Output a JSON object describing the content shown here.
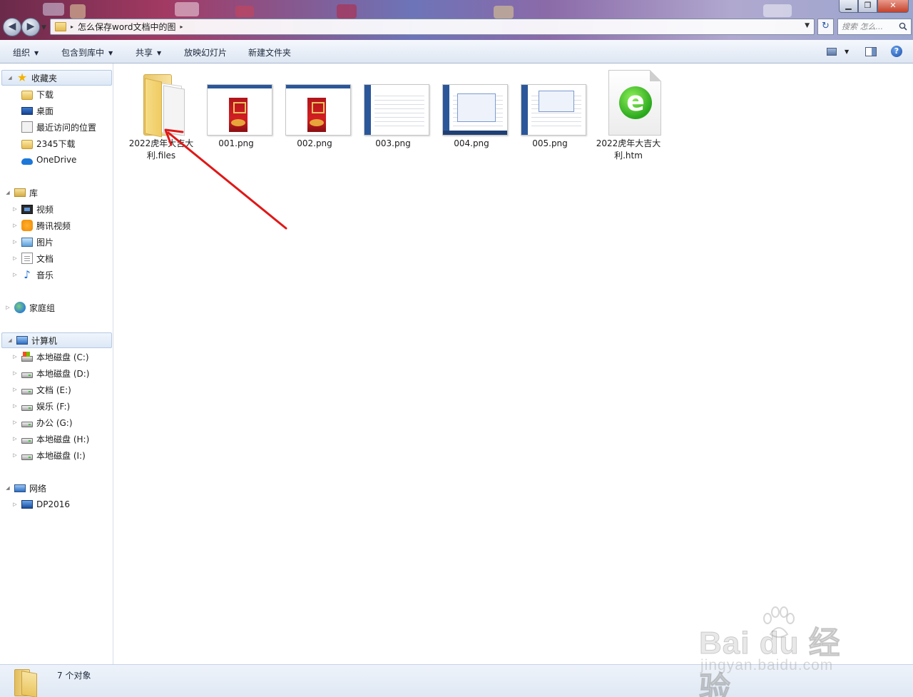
{
  "window": {
    "minimize_glyph": "▁",
    "restore_glyph": "❐",
    "close_glyph": "✕"
  },
  "address": {
    "path": "怎么保存word文档中的图",
    "breadcrumb_separator": "▸",
    "dropdown_glyph": "▼",
    "refresh_glyph": "↻",
    "search_placeholder": "搜索 怎么..."
  },
  "nav": {
    "back_glyph": "◀",
    "forward_glyph": "▶",
    "history_glyph": "▼"
  },
  "toolbar": {
    "organize": "组织",
    "include_in_library": "包含到库中",
    "share": "共享",
    "slideshow": "放映幻灯片",
    "new_folder": "新建文件夹",
    "caret": "▼",
    "help_glyph": "?"
  },
  "sidebar": {
    "expand_open": "◢",
    "expand_closed": "▷",
    "favorites": {
      "label": "收藏夹",
      "items": [
        "下载",
        "桌面",
        "最近访问的位置",
        "2345下载",
        "OneDrive"
      ]
    },
    "libraries": {
      "label": "库",
      "items": [
        "视频",
        "腾讯视频",
        "图片",
        "文档",
        "音乐"
      ]
    },
    "homegroup": {
      "label": "家庭组"
    },
    "computer": {
      "label": "计算机",
      "items": [
        "本地磁盘 (C:)",
        "本地磁盘 (D:)",
        "文档 (E:)",
        "娱乐 (F:)",
        "办公 (G:)",
        "本地磁盘 (H:)",
        "本地磁盘 (I:)"
      ]
    },
    "network": {
      "label": "网络",
      "items": [
        "DP2016"
      ]
    }
  },
  "files": [
    {
      "name": "2022虎年大吉大利.files",
      "type": "folder"
    },
    {
      "name": "001.png",
      "type": "png",
      "preview": "red-poster"
    },
    {
      "name": "002.png",
      "type": "png",
      "preview": "red-poster"
    },
    {
      "name": "003.png",
      "type": "png",
      "preview": "word-document"
    },
    {
      "name": "004.png",
      "type": "png",
      "preview": "dialog-screenshot"
    },
    {
      "name": "005.png",
      "type": "png",
      "preview": "dialog-screenshot"
    },
    {
      "name": "2022虎年大吉大利.htm",
      "type": "htm",
      "icon": "ie-e-icon"
    }
  ],
  "status": {
    "count": "7 个对象"
  },
  "watermark": {
    "brand": "Bai du 经验",
    "url": "jingyan.baidu.com"
  },
  "colors": {
    "annotation_arrow": "#e01818",
    "selection": "#dde8f6",
    "toolbar_text": "#1e2a3d"
  }
}
